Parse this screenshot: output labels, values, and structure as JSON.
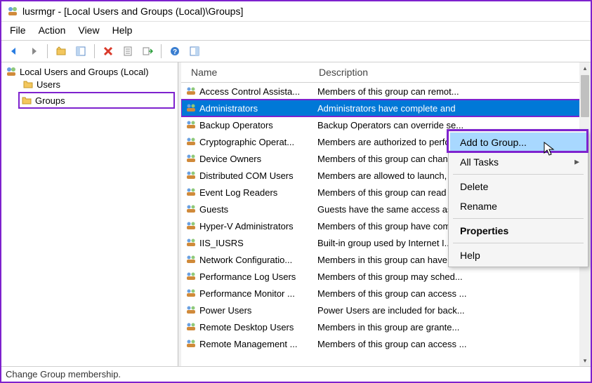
{
  "window": {
    "title": "lusrmgr - [Local Users and Groups (Local)\\Groups]"
  },
  "menubar": {
    "file": "File",
    "action": "Action",
    "view": "View",
    "help": "Help"
  },
  "tree": {
    "root": "Local Users and Groups (Local)",
    "users": "Users",
    "groups": "Groups"
  },
  "columns": {
    "name": "Name",
    "description": "Description"
  },
  "groups": [
    {
      "name": "Access Control Assista...",
      "desc": "Members of this group can remot..."
    },
    {
      "name": "Administrators",
      "desc": "Administrators have complete and ",
      "selected": true
    },
    {
      "name": "Backup Operators",
      "desc": "Backup Operators can override se..."
    },
    {
      "name": "Cryptographic Operat...",
      "desc": "Members are authorized to perfo..."
    },
    {
      "name": "Device Owners",
      "desc": "Members of this group can chan..."
    },
    {
      "name": "Distributed COM Users",
      "desc": "Members are allowed to launch, ..."
    },
    {
      "name": "Event Log Readers",
      "desc": "Members of this group can read ..."
    },
    {
      "name": "Guests",
      "desc": "Guests have the same access as ..."
    },
    {
      "name": "Hyper-V Administrators",
      "desc": "Members of this group have com..."
    },
    {
      "name": "IIS_IUSRS",
      "desc": "Built-in group used by Internet I..."
    },
    {
      "name": "Network Configuratio...",
      "desc": "Members in this group can have s..."
    },
    {
      "name": "Performance Log Users",
      "desc": "Members of this group may sched..."
    },
    {
      "name": "Performance Monitor ...",
      "desc": "Members of this group can access ..."
    },
    {
      "name": "Power Users",
      "desc": "Power Users are included for back..."
    },
    {
      "name": "Remote Desktop Users",
      "desc": "Members in this group are grante..."
    },
    {
      "name": "Remote Management ...",
      "desc": "Members of this group can access ..."
    }
  ],
  "context_menu": {
    "add_to_group": "Add to Group...",
    "all_tasks": "All Tasks",
    "delete": "Delete",
    "rename": "Rename",
    "properties": "Properties",
    "help": "Help"
  },
  "statusbar": {
    "text": "Change Group membership."
  }
}
